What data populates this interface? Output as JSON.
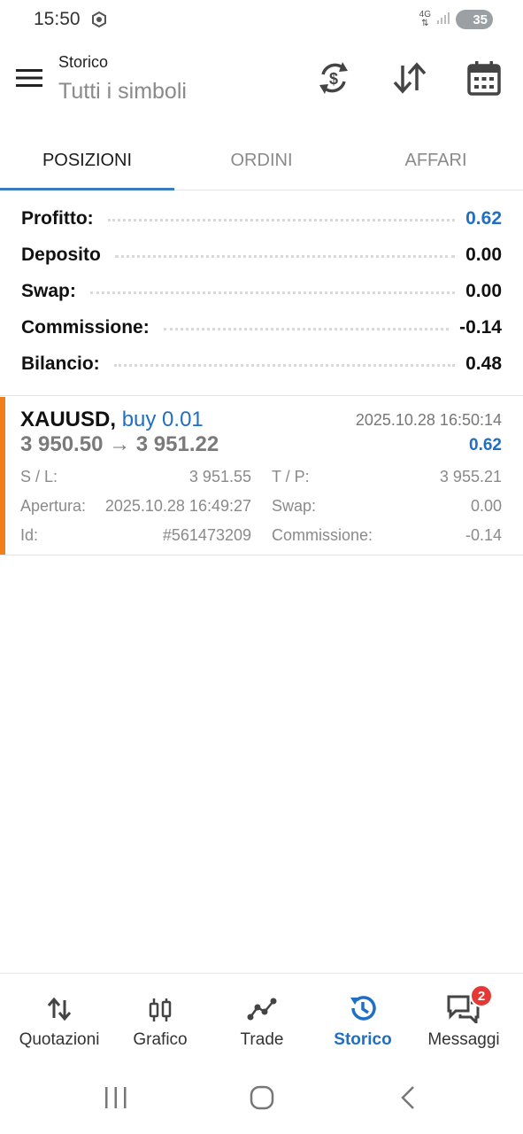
{
  "status_bar": {
    "time": "15:50",
    "network": "4G",
    "battery": "35"
  },
  "app_bar": {
    "title": "Storico",
    "subtitle": "Tutti i simboli"
  },
  "tabs": [
    {
      "label": "POSIZIONI",
      "active": true
    },
    {
      "label": "ORDINI",
      "active": false
    },
    {
      "label": "AFFARI",
      "active": false
    }
  ],
  "summary": {
    "profit_label": "Profitto:",
    "profit_value": "0.62",
    "deposit_label": "Deposito",
    "deposit_value": "0.00",
    "swap_label": "Swap:",
    "swap_value": "0.00",
    "commission_label": "Commissione:",
    "commission_value": "-0.14",
    "balance_label": "Bilancio:",
    "balance_value": "0.48"
  },
  "position": {
    "symbol": "XAUUSD",
    "separator": ",",
    "type": "buy 0.01",
    "time": "2025.10.28 16:50:14",
    "prices": "3 950.50 → 3 951.22",
    "profit": "0.62",
    "sl_label": "S / L:",
    "sl_value": "3 951.55",
    "tp_label": "T / P:",
    "tp_value": "3 955.21",
    "open_label": "Apertura:",
    "open_value": "2025.10.28 16:49:27",
    "swap_label": "Swap:",
    "swap_value": "0.00",
    "id_label": "Id:",
    "id_value": "#561473209",
    "commission_label": "Commissione:",
    "commission_value": "-0.14"
  },
  "bottom_nav": [
    {
      "label": "Quotazioni",
      "icon": "quotes-icon"
    },
    {
      "label": "Grafico",
      "icon": "chart-icon"
    },
    {
      "label": "Trade",
      "icon": "trade-icon"
    },
    {
      "label": "Storico",
      "icon": "history-icon",
      "active": true
    },
    {
      "label": "Messaggi",
      "icon": "messages-icon",
      "badge": "2"
    }
  ],
  "colors": {
    "accent": "#1f6fc5",
    "position_bar": "#f07f1b",
    "badge": "#e53935"
  }
}
